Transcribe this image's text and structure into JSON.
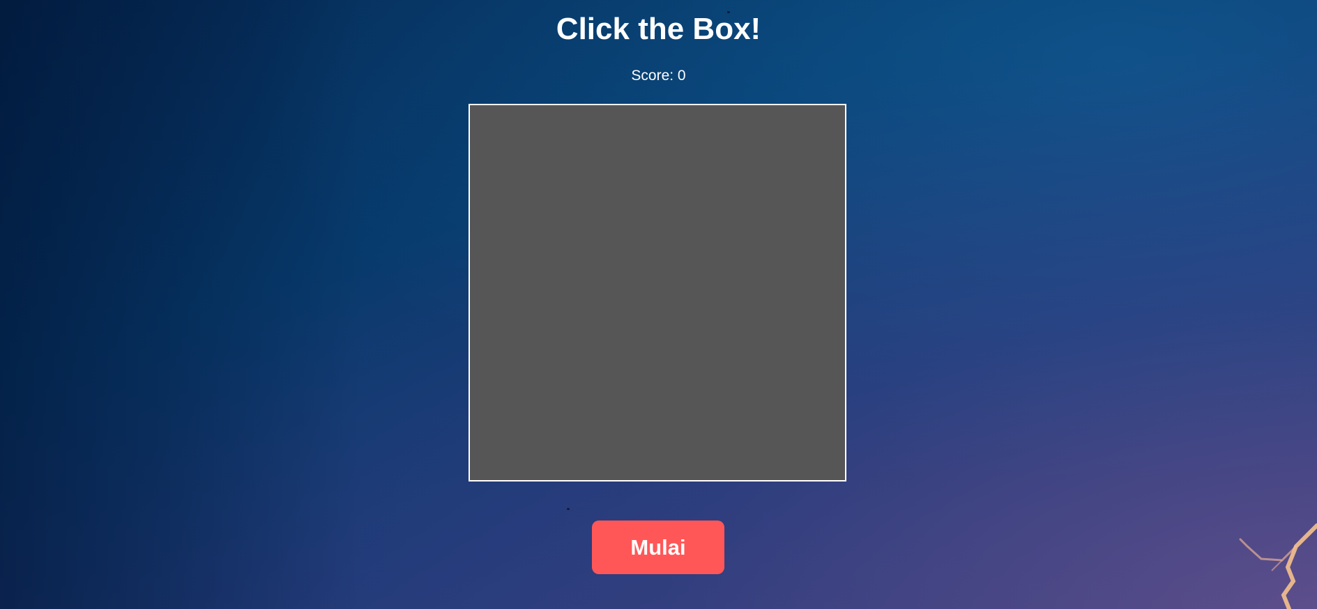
{
  "game": {
    "title": "Click the Box!",
    "score_label": "Score: 0",
    "start_button_label": "Mulai"
  },
  "colors": {
    "game_area_fill": "#565656",
    "game_area_border": "#ffffff",
    "start_button": "#ff5757",
    "text": "#ffffff"
  }
}
